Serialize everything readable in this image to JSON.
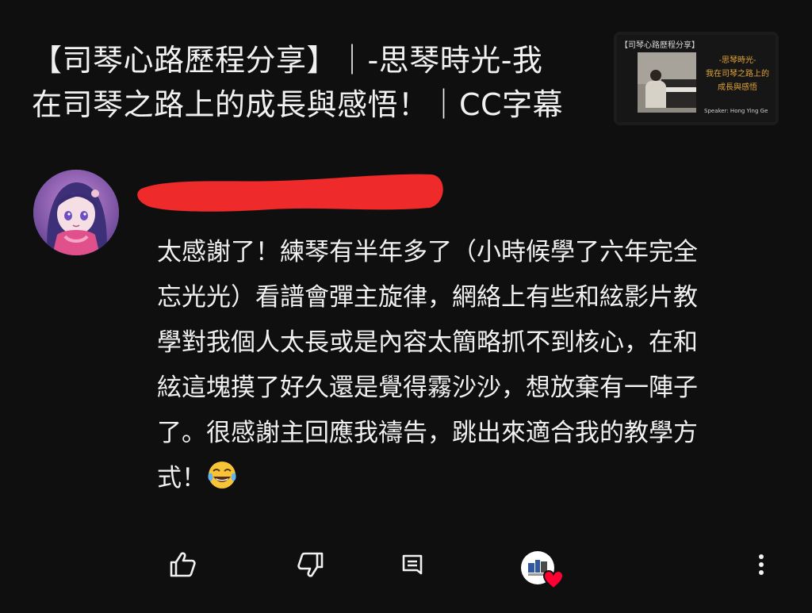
{
  "video": {
    "title_line1": "【司琴心路歷程分享】｜-思琴時光-我",
    "title_line2": "在司琴之路上的成長與感悟！｜CC字幕",
    "thumbnail": {
      "header": "【司琴心路歷程分享】",
      "line1": "-思琴時光-",
      "line2": "我在司琴之路上的",
      "line3": "成長與感悟",
      "speaker": "Speaker: Hong Ying Ge"
    }
  },
  "comment": {
    "lines": [
      "太感謝了！練琴有半年多了（小時候學了六年完全",
      "忘光光）看譜會彈主旋律，網絡上有些和絃影片教",
      "學對我個人太長或是內容太簡略抓不到核心，在和",
      "絃這塊摸了好久還是覺得霧沙沙，想放棄有一陣子",
      "了。很感謝主回應我禱告，跳出來適合我的教學方",
      "式！"
    ],
    "emoji": "face-with-tears-of-joy"
  },
  "actions": {
    "like_icon": "thumbs-up-icon",
    "dislike_icon": "thumbs-down-icon",
    "reply_icon": "reply-icon",
    "heart_icon": "creator-heart-icon",
    "more_icon": "more-vertical-icon"
  },
  "colors": {
    "background": "#0f0f0f",
    "text": "#f1f1f1",
    "redaction": "#ee2a2a",
    "heart": "#ff0033",
    "thumb_accent": "#e0a33a"
  }
}
